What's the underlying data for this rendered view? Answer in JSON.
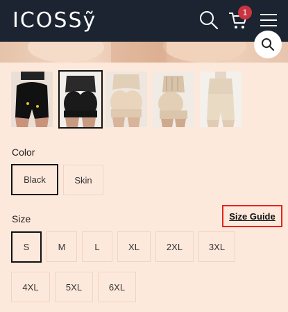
{
  "header": {
    "logo": "ICOSSỹ",
    "cart_count": "1"
  },
  "thumbnails": [
    {
      "alt": "black-front",
      "selected": false
    },
    {
      "alt": "black-back",
      "selected": true
    },
    {
      "alt": "skin-back",
      "selected": false
    },
    {
      "alt": "skin-side",
      "selected": false
    },
    {
      "alt": "skin-front",
      "selected": false
    }
  ],
  "color": {
    "label": "Color",
    "options": [
      "Black",
      "Skin"
    ],
    "selected": "Black"
  },
  "size": {
    "label": "Size",
    "guide_label": "Size Guide",
    "row1": [
      "S",
      "M",
      "L",
      "XL",
      "2XL",
      "3XL"
    ],
    "row2": [
      "4XL",
      "5XL",
      "6XL"
    ],
    "selected": "S"
  },
  "colors": {
    "header_bg": "#1b2430",
    "page_bg": "#fde9dc",
    "badge": "#c8343f",
    "highlight": "#e5231c"
  }
}
